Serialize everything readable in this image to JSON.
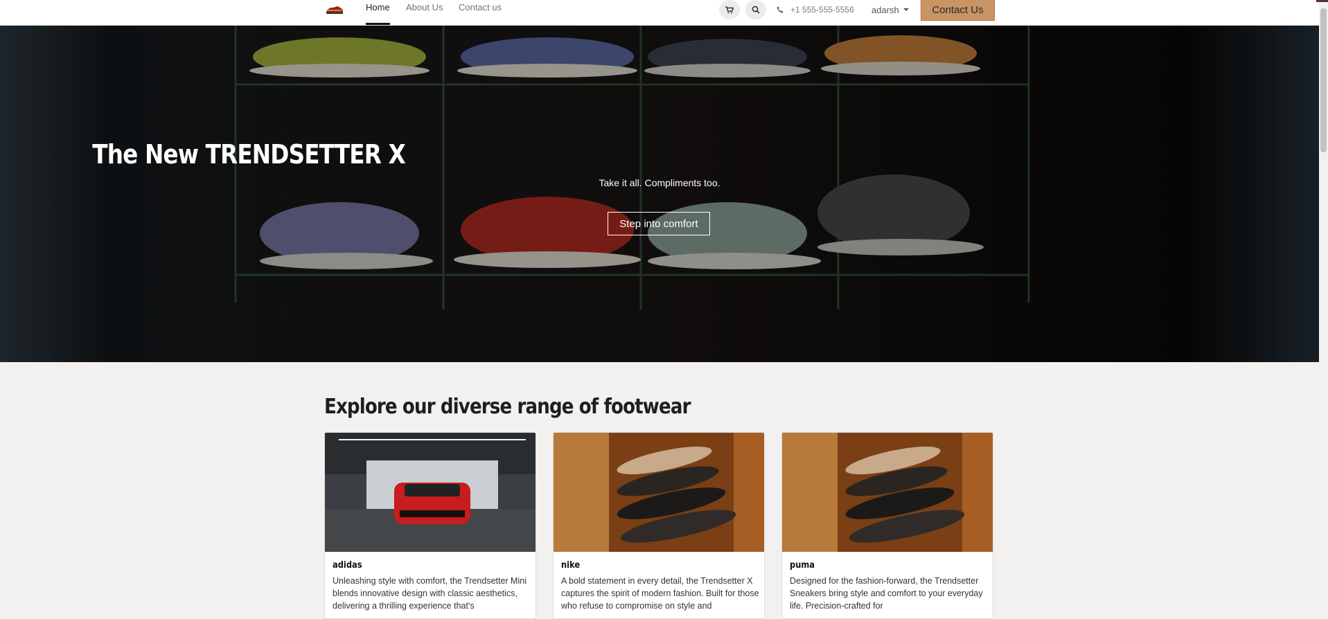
{
  "nav": {
    "items": [
      {
        "label": "Home",
        "active": true
      },
      {
        "label": "About Us",
        "active": false
      },
      {
        "label": "Contact us",
        "active": false
      }
    ],
    "phone": "+1 555-555-5556",
    "user": "adarsh",
    "contact_button": "Contact Us",
    "icons": [
      "cart-icon",
      "search-icon",
      "phone-icon"
    ]
  },
  "hero": {
    "title": "The New TRENDSETTER X",
    "subtitle": "Take it all. Compliments too.",
    "cta": "Step into comfort"
  },
  "section": {
    "title": "Explore our diverse range of footwear",
    "cards": [
      {
        "title": "adidas",
        "text": "Unleashing style with comfort, the Trendsetter Mini blends innovative design with classic aesthetics, delivering a thrilling experience that's"
      },
      {
        "title": "nike",
        "text": "A bold statement in every detail, the Trendsetter X captures the spirit of modern fashion. Built for those who refuse to compromise on style and"
      },
      {
        "title": "puma",
        "text": "Designed for the fashion-forward, the Trendsetter Sneakers bring style and comfort to your everyday life. Precision-crafted for"
      }
    ]
  },
  "colors": {
    "accent": "#c89463",
    "background": "#f3f1ef"
  }
}
